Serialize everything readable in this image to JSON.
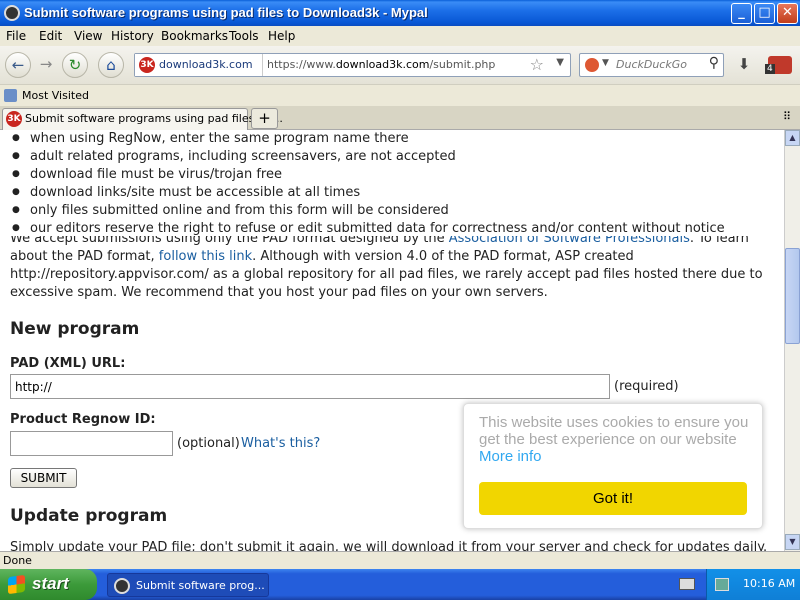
{
  "window": {
    "title": "Submit software programs using pad files to Download3k - Mypal",
    "buttons": {
      "minimize": "_",
      "maximize": "□",
      "close": "✕"
    }
  },
  "menu": [
    "File",
    "Edit",
    "View",
    "History",
    "Bookmarks",
    "Tools",
    "Help"
  ],
  "toolbar": {
    "back": "←",
    "forward": "→",
    "reload": "↻",
    "home": "⌂",
    "site_badge": "download3k.com",
    "site_icon": "3K",
    "url_prefix": "https://www.",
    "url_domain": "download3k.com",
    "url_path": "/submit.php",
    "bookmark_star": "☆",
    "dropdown": "▼",
    "search_placeholder": "DuckDuckGo",
    "search_icon": "search-icon",
    "download": "⬇",
    "addon_badge": "4"
  },
  "bookmarks_bar": {
    "most_visited": "Most Visited"
  },
  "tabs": [
    {
      "label": "Submit software programs using pad files to ..."
    }
  ],
  "new_tab": "+",
  "tab_list": "⠿",
  "page": {
    "rules": [
      "when using RegNow, enter the same program name there",
      "adult related programs, including screensavers, are not accepted",
      "download file must be virus/trojan free",
      "download links/site must be accessible at all times",
      "only files submitted online and from this form will be considered",
      "our editors reserve the right to refuse or edit submitted data for correctness and/or content without notice"
    ],
    "intro_pre": "We accept submissions using only the PAD format designed by the ",
    "intro_link1": "Association of Software Professionals",
    "intro_mid": ". To learn about the PAD format, ",
    "intro_link2": "follow this link",
    "intro_post": ". Although with version 4.0 of the PAD format, ASP created http://repository.appvisor.com/ as a global repository for all pad files, we rarely accept pad files hosted there due to excessive spam. We recommend that you host your pad files on your own servers.",
    "new_program_heading": "New program",
    "pad_label": "PAD (XML) URL:",
    "pad_value": "http://",
    "pad_required": "(required)",
    "regnow_label": "Product Regnow ID:",
    "regnow_value": "",
    "regnow_optional": "(optional)",
    "whats_this": "What's this?",
    "submit": "SUBMIT",
    "update_heading": "Update program",
    "update_text": "Simply update your PAD file; don't submit it again, we will download it from your server and check for updates daily."
  },
  "cookie": {
    "message": "This website uses cookies to ensure you get the best experience on our website ",
    "more_info": "More info",
    "got_it": "Got it!"
  },
  "status": "Done",
  "taskbar": {
    "start": "start",
    "window_item": "Submit software prog...",
    "time": "10:16 AM"
  }
}
